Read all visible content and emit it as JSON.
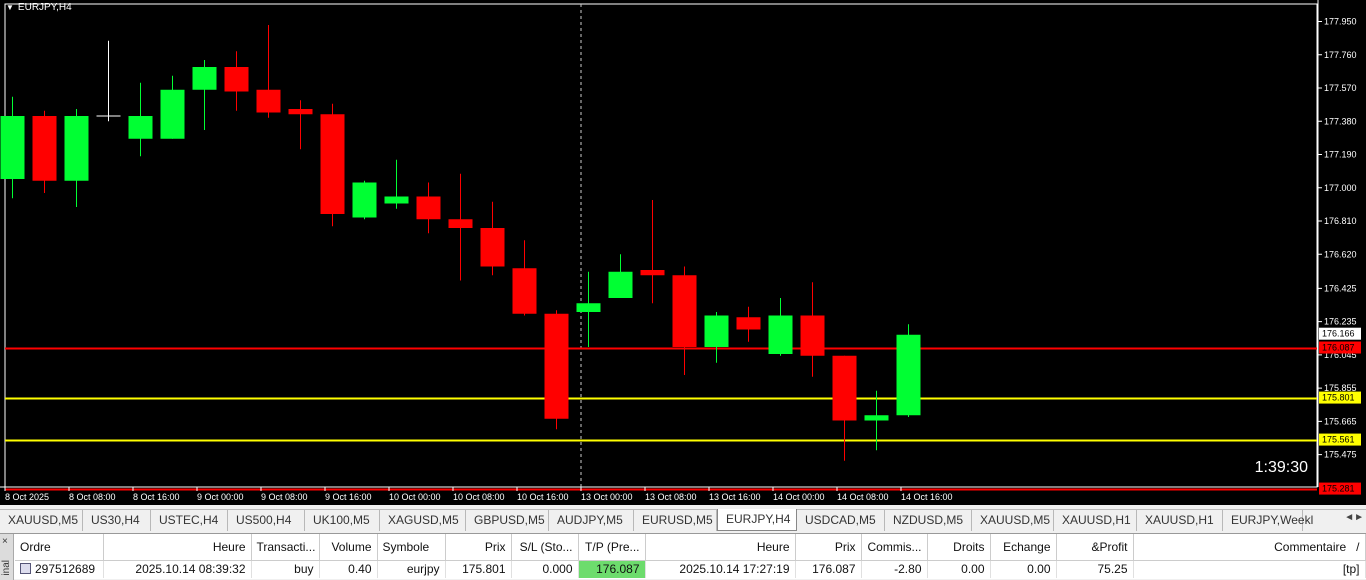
{
  "chart": {
    "title": "EURJPY,H4",
    "timer": "1:39:30",
    "colors": {
      "bull": "#00ff33",
      "bear": "#ff0000",
      "wick": "#ffffff",
      "line_red": "#ff0000",
      "line_yellow": "#ffff00",
      "bg": "#000000"
    }
  },
  "price_axis": {
    "ticks": [
      "177.950",
      "177.760",
      "177.570",
      "177.380",
      "177.190",
      "177.000",
      "176.810",
      "176.620",
      "176.425",
      "176.235",
      "176.045",
      "175.855",
      "175.665",
      "175.475"
    ],
    "labels": [
      {
        "text": "176.166",
        "price": 176.166,
        "bg": "#ffffff",
        "color": "#000000"
      },
      {
        "text": "176.087",
        "price": 176.087,
        "bg": "#ff0000",
        "color": "#000000"
      },
      {
        "text": "175.801",
        "price": 175.801,
        "bg": "#ffff00",
        "color": "#000000"
      },
      {
        "text": "175.561",
        "price": 175.561,
        "bg": "#ffff00",
        "color": "#000000"
      },
      {
        "text": "175.281",
        "price": 175.281,
        "bg": "#ff0000",
        "color": "#000000"
      }
    ]
  },
  "time_axis": {
    "ticks": [
      "8 Oct 2025",
      "8 Oct 08:00",
      "8 Oct 16:00",
      "9 Oct 00:00",
      "9 Oct 08:00",
      "9 Oct 16:00",
      "10 Oct 00:00",
      "10 Oct 08:00",
      "10 Oct 16:00",
      "13 Oct 00:00",
      "13 Oct 08:00",
      "13 Oct 16:00",
      "14 Oct 00:00",
      "14 Oct 08:00",
      "14 Oct 16:00"
    ]
  },
  "chart_data": {
    "type": "candlestick",
    "symbol": "EURJPY",
    "timeframe": "H4",
    "ylim": [
      175.29,
      178.05
    ],
    "hlines": [
      {
        "price": 176.087,
        "color": "#ff0000"
      },
      {
        "price": 175.801,
        "color": "#ffff00"
      },
      {
        "price": 175.561,
        "color": "#ffff00"
      },
      {
        "price": 175.281,
        "color": "#ff0000"
      }
    ],
    "candles": [
      {
        "o": 177.05,
        "h": 177.52,
        "l": 176.94,
        "c": 177.41
      },
      {
        "o": 177.41,
        "h": 177.44,
        "l": 176.97,
        "c": 177.04
      },
      {
        "o": 177.04,
        "h": 177.45,
        "l": 176.89,
        "c": 177.41
      },
      {
        "o": 177.41,
        "h": 177.84,
        "l": 177.38,
        "c": 177.41
      },
      {
        "o": 177.28,
        "h": 177.6,
        "l": 177.18,
        "c": 177.41
      },
      {
        "o": 177.28,
        "h": 177.64,
        "l": 177.28,
        "c": 177.56
      },
      {
        "o": 177.56,
        "h": 177.73,
        "l": 177.33,
        "c": 177.69
      },
      {
        "o": 177.69,
        "h": 177.78,
        "l": 177.44,
        "c": 177.55
      },
      {
        "o": 177.56,
        "h": 177.93,
        "l": 177.4,
        "c": 177.43
      },
      {
        "o": 177.45,
        "h": 177.5,
        "l": 177.22,
        "c": 177.42
      },
      {
        "o": 177.42,
        "h": 177.48,
        "l": 176.78,
        "c": 176.85
      },
      {
        "o": 176.83,
        "h": 177.04,
        "l": 176.82,
        "c": 177.03
      },
      {
        "o": 176.91,
        "h": 177.16,
        "l": 176.88,
        "c": 176.95
      },
      {
        "o": 176.95,
        "h": 177.03,
        "l": 176.74,
        "c": 176.82
      },
      {
        "o": 176.82,
        "h": 177.08,
        "l": 176.47,
        "c": 176.77
      },
      {
        "o": 176.77,
        "h": 176.92,
        "l": 176.5,
        "c": 176.55
      },
      {
        "o": 176.54,
        "h": 176.7,
        "l": 176.27,
        "c": 176.28
      },
      {
        "o": 176.28,
        "h": 176.3,
        "l": 175.62,
        "c": 175.68
      },
      {
        "o": 176.29,
        "h": 176.52,
        "l": 176.09,
        "c": 176.34
      },
      {
        "o": 176.37,
        "h": 176.62,
        "l": 176.38,
        "c": 176.52
      },
      {
        "o": 176.53,
        "h": 176.93,
        "l": 176.34,
        "c": 176.5
      },
      {
        "o": 176.5,
        "h": 176.55,
        "l": 175.93,
        "c": 176.09
      },
      {
        "o": 176.09,
        "h": 176.29,
        "l": 176.0,
        "c": 176.27
      },
      {
        "o": 176.26,
        "h": 176.32,
        "l": 176.12,
        "c": 176.19
      },
      {
        "o": 176.05,
        "h": 176.37,
        "l": 176.04,
        "c": 176.27
      },
      {
        "o": 176.27,
        "h": 176.46,
        "l": 175.92,
        "c": 176.04
      },
      {
        "o": 176.04,
        "h": 176.04,
        "l": 175.44,
        "c": 175.67
      },
      {
        "o": 175.67,
        "h": 175.84,
        "l": 175.5,
        "c": 175.7
      },
      {
        "o": 175.7,
        "h": 176.22,
        "l": 175.69,
        "c": 176.16
      }
    ]
  },
  "tabs": [
    {
      "label": "XAUUSD,M5",
      "active": false
    },
    {
      "label": "US30,H4",
      "active": false
    },
    {
      "label": "USTEC,H4",
      "active": false
    },
    {
      "label": "US500,H4",
      "active": false
    },
    {
      "label": "UK100,M5",
      "active": false
    },
    {
      "label": "XAGUSD,M5",
      "active": false
    },
    {
      "label": "GBPUSD,M5",
      "active": false
    },
    {
      "label": "AUDJPY,M5",
      "active": false
    },
    {
      "label": "EURUSD,M5",
      "active": false
    },
    {
      "label": "EURJPY,H4",
      "active": true
    },
    {
      "label": "USDCAD,M5",
      "active": false
    },
    {
      "label": "NZDUSD,M5",
      "active": false
    },
    {
      "label": "XAUUSD,M5",
      "active": false
    },
    {
      "label": "XAUUSD,H1",
      "active": false
    },
    {
      "label": "XAUUSD,H1",
      "active": false
    },
    {
      "label": "EURJPY,Weekl",
      "active": false
    }
  ],
  "terminal": {
    "side_label": "inal",
    "columns": [
      "Ordre",
      "Heure",
      "Transacti...",
      "Volume",
      "Symbole",
      "Prix",
      "S/L (Sto...",
      "T/P (Pre...",
      "Heure",
      "Prix",
      "Commis...",
      "Droits",
      "Echange",
      "&Profit",
      "Commentaire"
    ],
    "sort_mark": "/",
    "rows": [
      [
        "297512689",
        "2025.10.14 08:39:32",
        "buy",
        "0.40",
        "eurjpy",
        "175.801",
        "0.000",
        "176.087",
        "2025.10.14 17:27:19",
        "176.087",
        "-2.80",
        "0.00",
        "0.00",
        "75.25",
        "[tp]"
      ]
    ]
  }
}
